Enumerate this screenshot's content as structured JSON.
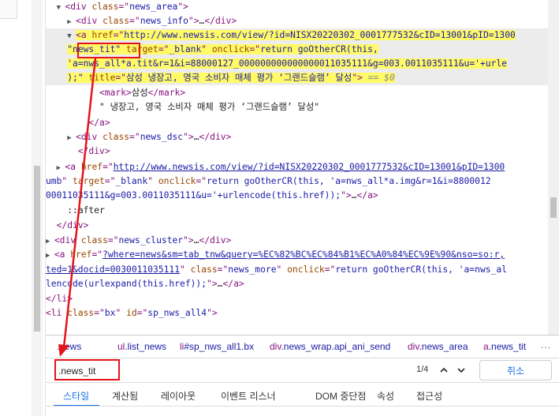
{
  "tree": {
    "lines": [
      {
        "indent": "  ",
        "arrow": "▼",
        "parts": [
          {
            "c": "tag",
            "t": "<div "
          },
          {
            "c": "attr",
            "t": "class"
          },
          {
            "c": "tag",
            "t": "=\""
          },
          {
            "c": "val",
            "t": "news_area"
          },
          {
            "c": "tag",
            "t": "\">"
          }
        ]
      },
      {
        "indent": "    ",
        "arrow": "▶",
        "parts": [
          {
            "c": "tag",
            "t": "<div "
          },
          {
            "c": "attr",
            "t": "class"
          },
          {
            "c": "tag",
            "t": "=\""
          },
          {
            "c": "val",
            "t": "news_info"
          },
          {
            "c": "tag",
            "t": "\">"
          },
          {
            "c": "txt",
            "t": "…"
          },
          {
            "c": "tag",
            "t": "</div>"
          }
        ]
      },
      {
        "indent": "    ",
        "arrow": "▼",
        "hl": true,
        "parts": [
          {
            "c": "tag",
            "t": "<a "
          },
          {
            "c": "attr",
            "t": "href"
          },
          {
            "c": "tag",
            "t": "=\""
          },
          {
            "c": "val",
            "t": "http://www.newsis.com/view/?id=NISX20220302_0001777532&cID=13001&pID=1300"
          }
        ]
      },
      {
        "indent": "    ",
        "hl": true,
        "parts": [
          {
            "c": "val",
            "t": "\"news_tit\""
          },
          {
            "c": "attr",
            "t": " target"
          },
          {
            "c": "tag",
            "t": "=\""
          },
          {
            "c": "val",
            "t": "_blank"
          },
          {
            "c": "tag",
            "t": "\" "
          },
          {
            "c": "attr",
            "t": "onclick"
          },
          {
            "c": "tag",
            "t": "=\""
          },
          {
            "c": "val",
            "t": "return goOtherCR(this,"
          }
        ]
      },
      {
        "indent": "    ",
        "hl": true,
        "parts": [
          {
            "c": "val",
            "t": "'a=nws_all*a.tit&r=1&i=88000127_000000000000000011035111&g=003.0011035111&u='+urle"
          }
        ]
      },
      {
        "indent": "    ",
        "hl": true,
        "parts": [
          {
            "c": "val",
            "t": ");\""
          },
          {
            "c": "attr",
            "t": " title"
          },
          {
            "c": "tag",
            "t": "=\""
          },
          {
            "c": "val",
            "t": "삼성 냉장고, 영국 소비자 매체 평가 ‘그랜드슬램’ 달성"
          },
          {
            "c": "tag",
            "t": "\">"
          },
          {
            "c": "dim",
            "t": " == $0"
          }
        ]
      },
      {
        "indent": "          ",
        "parts": [
          {
            "c": "tag",
            "t": "<mark>"
          },
          {
            "c": "txt",
            "t": "삼성"
          },
          {
            "c": "tag",
            "t": "</mark>"
          }
        ]
      },
      {
        "indent": "          ",
        "parts": [
          {
            "c": "txt",
            "t": "\" 냉장고, 영국 소비자 매체 평가 ‘그랜드슬램’ 달성\""
          }
        ]
      },
      {
        "indent": "        ",
        "parts": [
          {
            "c": "tag",
            "t": "</a>"
          }
        ]
      },
      {
        "indent": "    ",
        "arrow": "▶",
        "parts": [
          {
            "c": "tag",
            "t": "<div "
          },
          {
            "c": "attr",
            "t": "class"
          },
          {
            "c": "tag",
            "t": "=\""
          },
          {
            "c": "val",
            "t": "news_dsc"
          },
          {
            "c": "tag",
            "t": "\">"
          },
          {
            "c": "txt",
            "t": "…"
          },
          {
            "c": "tag",
            "t": "</div>"
          }
        ]
      },
      {
        "indent": "      ",
        "parts": [
          {
            "c": "tag",
            "t": "</div>"
          }
        ]
      },
      {
        "indent": "  ",
        "arrow": "▶",
        "parts": [
          {
            "c": "tag",
            "t": "<a "
          },
          {
            "c": "attr",
            "t": "href"
          },
          {
            "c": "tag",
            "t": "=\""
          },
          {
            "c": "link",
            "t": "http://www.newsis.com/view/?id=NISX20220302_0001777532&cID=13001&pID=1300"
          }
        ]
      },
      {
        "indent": "",
        "parts": [
          {
            "c": "val",
            "t": "umb"
          },
          {
            "c": "tag",
            "t": "\" "
          },
          {
            "c": "attr",
            "t": "target"
          },
          {
            "c": "tag",
            "t": "=\""
          },
          {
            "c": "val",
            "t": "_blank"
          },
          {
            "c": "tag",
            "t": "\" "
          },
          {
            "c": "attr",
            "t": "onclick"
          },
          {
            "c": "tag",
            "t": "=\""
          },
          {
            "c": "val",
            "t": "return goOtherCR(this, 'a=nws_all*a.img&r=1&i=8800012"
          }
        ]
      },
      {
        "indent": "",
        "parts": [
          {
            "c": "val",
            "t": "00011035111&g=003.0011035111&u='+urlencode(this.href));"
          },
          {
            "c": "tag",
            "t": "\">"
          },
          {
            "c": "txt",
            "t": "…"
          },
          {
            "c": "tag",
            "t": "</a>"
          }
        ]
      },
      {
        "indent": "    ",
        "parts": [
          {
            "c": "txt",
            "t": "::after"
          }
        ]
      },
      {
        "indent": "  ",
        "parts": [
          {
            "c": "tag",
            "t": "</div>"
          }
        ]
      },
      {
        "indent": "",
        "arrow": "▶",
        "parts": [
          {
            "c": "tag",
            "t": "<div "
          },
          {
            "c": "attr",
            "t": "class"
          },
          {
            "c": "tag",
            "t": "=\""
          },
          {
            "c": "val",
            "t": "news_cluster"
          },
          {
            "c": "tag",
            "t": "\">"
          },
          {
            "c": "txt",
            "t": "…"
          },
          {
            "c": "tag",
            "t": "</div>"
          }
        ]
      },
      {
        "indent": "",
        "arrow": "▶",
        "parts": [
          {
            "c": "tag",
            "t": "<a "
          },
          {
            "c": "attr",
            "t": "href"
          },
          {
            "c": "tag",
            "t": "=\""
          },
          {
            "c": "link",
            "t": "?where=news&sm=tab_tnw&query=%EC%82%BC%EC%84%B1%EC%A0%84%EC%9E%90&nso=so:r,"
          }
        ]
      },
      {
        "indent": "",
        "parts": [
          {
            "c": "link",
            "t": "ted=1&docid=0030011035111"
          },
          {
            "c": "tag",
            "t": "\" "
          },
          {
            "c": "attr",
            "t": "class"
          },
          {
            "c": "tag",
            "t": "=\""
          },
          {
            "c": "val",
            "t": "news_more"
          },
          {
            "c": "tag",
            "t": "\" "
          },
          {
            "c": "attr",
            "t": "onclick"
          },
          {
            "c": "tag",
            "t": "=\""
          },
          {
            "c": "val",
            "t": "return goOtherCR(this, 'a=nws_al"
          }
        ]
      },
      {
        "indent": "",
        "parts": [
          {
            "c": "val",
            "t": "lencode(urlexpand(this.href));"
          },
          {
            "c": "tag",
            "t": "\">"
          },
          {
            "c": "txt",
            "t": "…"
          },
          {
            "c": "tag",
            "t": "</a>"
          }
        ]
      },
      {
        "indent": "",
        "parts": [
          {
            "c": "tag",
            "t": "</li>"
          }
        ]
      },
      {
        "indent": "",
        "parts": [
          {
            "c": "tag",
            "t": "<li "
          },
          {
            "c": "attr",
            "t": "class"
          },
          {
            "c": "tag",
            "t": "=\""
          },
          {
            "c": "val",
            "t": "bx"
          },
          {
            "c": "tag",
            "t": "\" "
          },
          {
            "c": "attr",
            "t": "id"
          },
          {
            "c": "tag",
            "t": "=\""
          },
          {
            "c": "val",
            "t": "sp_nws_all4"
          },
          {
            "c": "tag",
            "t": "\">"
          }
        ]
      }
    ]
  },
  "breadcrumb": {
    "items": [
      {
        "tag": "",
        "cls": ".news"
      },
      {
        "tag": "ul",
        "cls": ".list_news"
      },
      {
        "tag": "li",
        "cls": "#sp_nws_all1.bx"
      },
      {
        "tag": "div",
        "cls": ".news_wrap.api_ani_send"
      },
      {
        "tag": "div",
        "cls": ".news_area"
      },
      {
        "tag": "a",
        "cls": ".news_tit"
      }
    ],
    "more": "…"
  },
  "search": {
    "value": ".news_tit",
    "count": "1/4",
    "cancel_label": "취소"
  },
  "tabs": [
    {
      "label": "스타일",
      "active": true
    },
    {
      "label": "계산됨"
    },
    {
      "label": "레이아웃"
    },
    {
      "label": "이벤트 리스너"
    },
    {
      "label": "DOM 중단점"
    },
    {
      "label": "속성"
    },
    {
      "label": "접근성"
    }
  ],
  "colors": {
    "annotation": "#e6131b",
    "highlight": "#fffa66",
    "accent": "#1a73e8"
  }
}
